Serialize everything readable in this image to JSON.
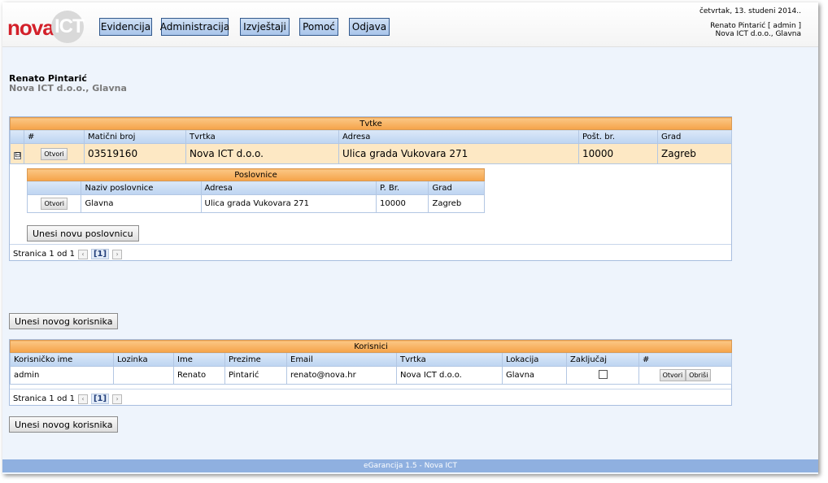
{
  "logo": {
    "word": "nova",
    "ict": "ICT"
  },
  "nav": [
    "Evidencija",
    "Administracija",
    "Izvještaji",
    "Pomoć",
    "Odjava"
  ],
  "user": {
    "date": "četvrtak, 13. studeni 2014..",
    "name_line": "Renato Pintarić [ admin ]",
    "company_line": "Nova ICT d.o.o., Glavna"
  },
  "page": {
    "name": "Renato Pintarić",
    "company": "Nova ICT d.o.o., Glavna"
  },
  "companies": {
    "caption": "Tvtke",
    "headers": [
      "#",
      "Matični broj",
      "Tvrtka",
      "Adresa",
      "Pošt. br.",
      "Grad"
    ],
    "row": {
      "expander": "⊟",
      "open": "Otvori",
      "mb": "03519160",
      "name": "Nova ICT d.o.o.",
      "address": "Ulica grada Vukovara 271",
      "post": "10000",
      "city": "Zagreb"
    },
    "branches": {
      "caption": "Poslovnice",
      "headers": [
        "Naziv poslovnice",
        "Adresa",
        "P. Br.",
        "Grad"
      ],
      "row": {
        "open": "Otvori",
        "name": "Glavna",
        "address": "Ulica grada Vukovara 271",
        "post": "10000",
        "city": "Zagreb"
      },
      "add_button": "Unesi novu poslovnicu"
    },
    "pager": {
      "label": "Stranica 1 od 1",
      "prev": "‹",
      "page": "[1]",
      "next": "›"
    }
  },
  "add_user_button": "Unesi novog korisnika",
  "users": {
    "caption": "Korisnici",
    "headers": [
      "Korisničko ime",
      "Lozinka",
      "Ime",
      "Prezime",
      "Email",
      "Tvrtka",
      "Lokacija",
      "Zaključaj",
      "#"
    ],
    "row": {
      "username": "admin",
      "password": "",
      "first": "Renato",
      "last": "Pintarić",
      "email": "renato@nova.hr",
      "company": "Nova ICT d.o.o.",
      "location": "Glavna",
      "locked": false,
      "open": "Otvori",
      "delete": "Obriši"
    },
    "pager": {
      "label": "Stranica 1 od 1",
      "prev": "‹",
      "page": "[1]",
      "next": "›"
    }
  },
  "footer": "eGarancija 1.5 - Nova ICT",
  "colors": {
    "accent_orange": "#f5a348",
    "accent_blue": "#a9c5ea",
    "brand_red": "#d3202a"
  }
}
